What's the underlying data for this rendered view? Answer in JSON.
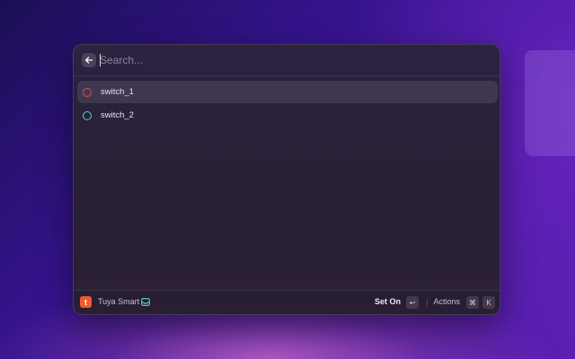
{
  "search": {
    "placeholder": "Search...",
    "back_icon": "arrow-left-icon"
  },
  "items": [
    {
      "label": "switch_1",
      "status_color": "#e8483c",
      "selected": true
    },
    {
      "label": "switch_2",
      "status_color": "#5fd3b0",
      "selected": false
    }
  ],
  "footer": {
    "extension_name": "Tuya Smart",
    "extension_icon_letter": "t",
    "extension_icon_color": "#ef5a2c",
    "dev_icon": "inbox-icon",
    "primary_action": "Set On",
    "primary_shortcut": "↩",
    "actions_label": "Actions",
    "actions_shortcut": [
      "⌘",
      "K"
    ]
  }
}
